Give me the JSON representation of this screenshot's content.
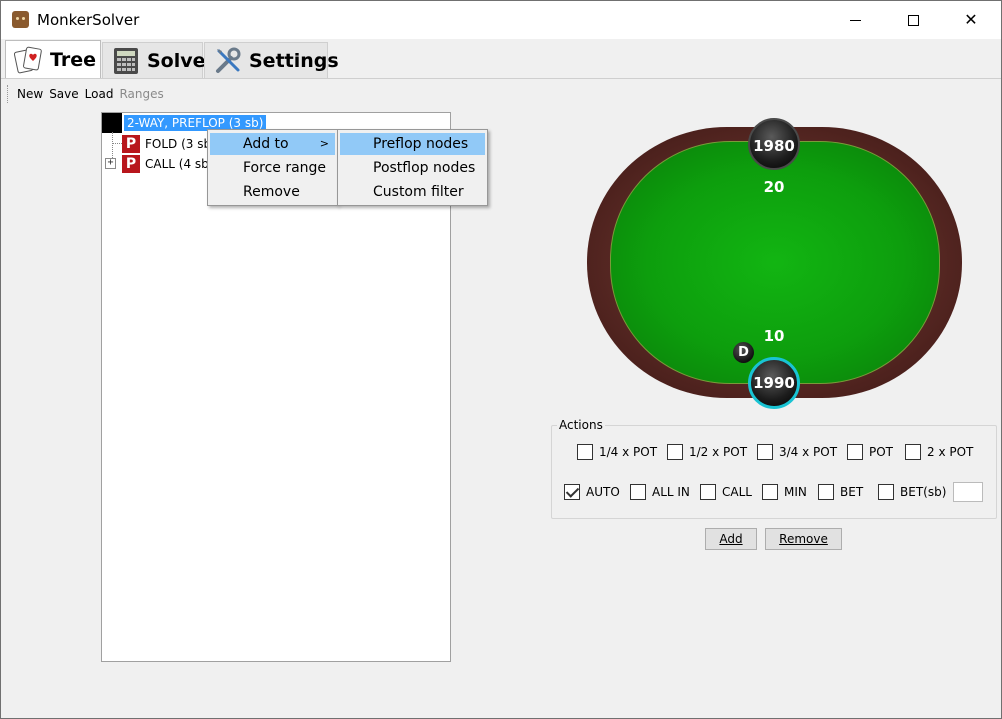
{
  "window": {
    "title": "MonkerSolver"
  },
  "tabs": [
    {
      "label": "Tree",
      "icon": "playing-cards-icon",
      "active": true
    },
    {
      "label": "Solve",
      "icon": "calculator-icon",
      "active": false
    },
    {
      "label": "Settings",
      "icon": "tools-icon",
      "active": false
    }
  ],
  "toolbar": {
    "items": [
      {
        "label": "New",
        "enabled": true
      },
      {
        "label": "Save",
        "enabled": true
      },
      {
        "label": "Load",
        "enabled": true
      },
      {
        "label": "Ranges",
        "enabled": false
      }
    ]
  },
  "tree": {
    "root": {
      "label": "2-WAY, PREFLOP (3 sb)",
      "selected": true
    },
    "children": [
      {
        "badge": "P",
        "label": "FOLD (3 sb",
        "expandable": false
      },
      {
        "badge": "P",
        "label": "CALL (4 sb",
        "expandable": true
      }
    ]
  },
  "context_menu": {
    "items": [
      {
        "label": "Add to",
        "has_submenu": true,
        "highlighted": true
      },
      {
        "label": "Force range",
        "has_submenu": false,
        "highlighted": false
      },
      {
        "label": "Remove",
        "has_submenu": false,
        "highlighted": false
      }
    ],
    "submenu": {
      "items": [
        {
          "label": "Preflop nodes",
          "highlighted": true
        },
        {
          "label": "Postflop nodes",
          "highlighted": false
        },
        {
          "label": "Custom filter",
          "highlighted": false
        }
      ]
    }
  },
  "table": {
    "top_seat": {
      "stack": "1980",
      "bet": "20"
    },
    "bottom_seat": {
      "stack": "1990",
      "bet": "10",
      "active": true
    },
    "dealer_label": "D",
    "colors": {
      "felt": "#0fa80f",
      "rail": "#4a201c",
      "active_ring": "#19c3d3"
    }
  },
  "actions": {
    "title": "Actions",
    "row1": [
      {
        "label": "1/4 x POT",
        "checked": false
      },
      {
        "label": "1/2 x POT",
        "checked": false
      },
      {
        "label": "3/4 x POT",
        "checked": false
      },
      {
        "label": "POT",
        "checked": false
      },
      {
        "label": "2 x POT",
        "checked": false
      }
    ],
    "row2": [
      {
        "label": "AUTO",
        "checked": true
      },
      {
        "label": "ALL IN",
        "checked": false
      },
      {
        "label": "CALL",
        "checked": false
      },
      {
        "label": "MIN",
        "checked": false
      },
      {
        "label": "BET",
        "checked": false
      },
      {
        "label": "BET(sb)",
        "checked": false
      }
    ],
    "bet_sb_value": "",
    "add_label": "Add",
    "remove_label": "Remove"
  }
}
